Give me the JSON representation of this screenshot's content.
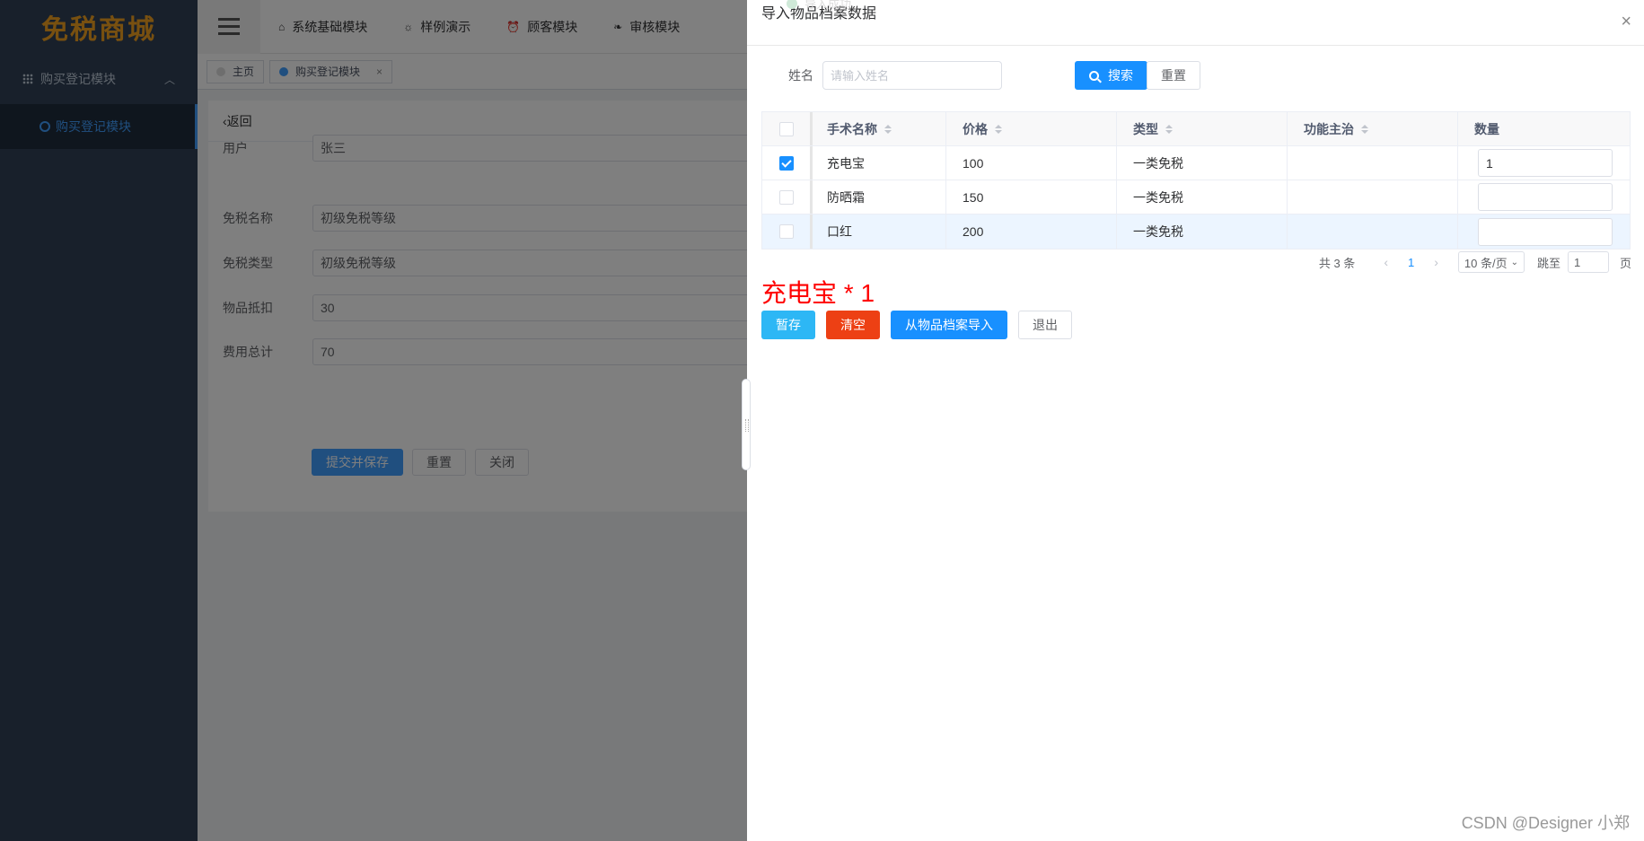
{
  "app": {
    "logo": "免税商城",
    "sidebar": {
      "group_label": "购买登记模块",
      "item_label": "购买登记模块"
    },
    "topnav": [
      {
        "label": "系统基础模块",
        "icon": "home-icon"
      },
      {
        "label": "样例演示",
        "icon": "bulb-icon"
      },
      {
        "label": "顾客模块",
        "icon": "alarm-icon"
      },
      {
        "label": "审核模块",
        "icon": "leaf-icon"
      }
    ],
    "tags": [
      {
        "label": "主页"
      },
      {
        "label": "购买登记模块"
      }
    ],
    "form": {
      "back_label": "返回",
      "fields": [
        {
          "label": "用户",
          "value": "张三"
        },
        {
          "label": "免税名称",
          "value": "初级免税等级"
        },
        {
          "label": "免税类型",
          "value": "初级免税等级"
        },
        {
          "label": "物品抵扣",
          "value": "30"
        },
        {
          "label": "费用总计",
          "value": "70"
        }
      ],
      "buttons": {
        "submit": "提交并保存",
        "reset": "重置",
        "close": "关闭"
      }
    }
  },
  "drawer": {
    "toast_ghost": "导入成功",
    "title": "导入物品档案数据",
    "search": {
      "label": "姓名",
      "placeholder": "请输入姓名",
      "search_button": "搜索",
      "reset_button": "重置"
    },
    "table": {
      "headers": [
        "手术名称",
        "价格",
        "类型",
        "功能主治",
        "数量"
      ],
      "rows": [
        {
          "checked": true,
          "name": "充电宝",
          "price": "100",
          "type": "一类免税",
          "func": "",
          "qty": "1"
        },
        {
          "checked": false,
          "name": "防晒霜",
          "price": "150",
          "type": "一类免税",
          "func": "",
          "qty": ""
        },
        {
          "checked": false,
          "name": "口红",
          "price": "200",
          "type": "一类免税",
          "func": "",
          "qty": ""
        }
      ]
    },
    "pagination": {
      "total": "共 3 条",
      "current": "1",
      "page_size": "10 条/页",
      "jump_label": "跳至",
      "jump_value": "1",
      "page_suffix": "页"
    },
    "summary": "充电宝 * 1",
    "actions": {
      "stash": "暂存",
      "clear": "清空",
      "import": "从物品档案导入",
      "quit": "退出"
    }
  },
  "watermark": "CSDN @Designer 小郑",
  "colors": {
    "primary": "#1890ff",
    "info": "#2db7f5",
    "danger": "#ed4014",
    "summary_red": "#ff0000",
    "sidebar_bg": "#304156"
  }
}
